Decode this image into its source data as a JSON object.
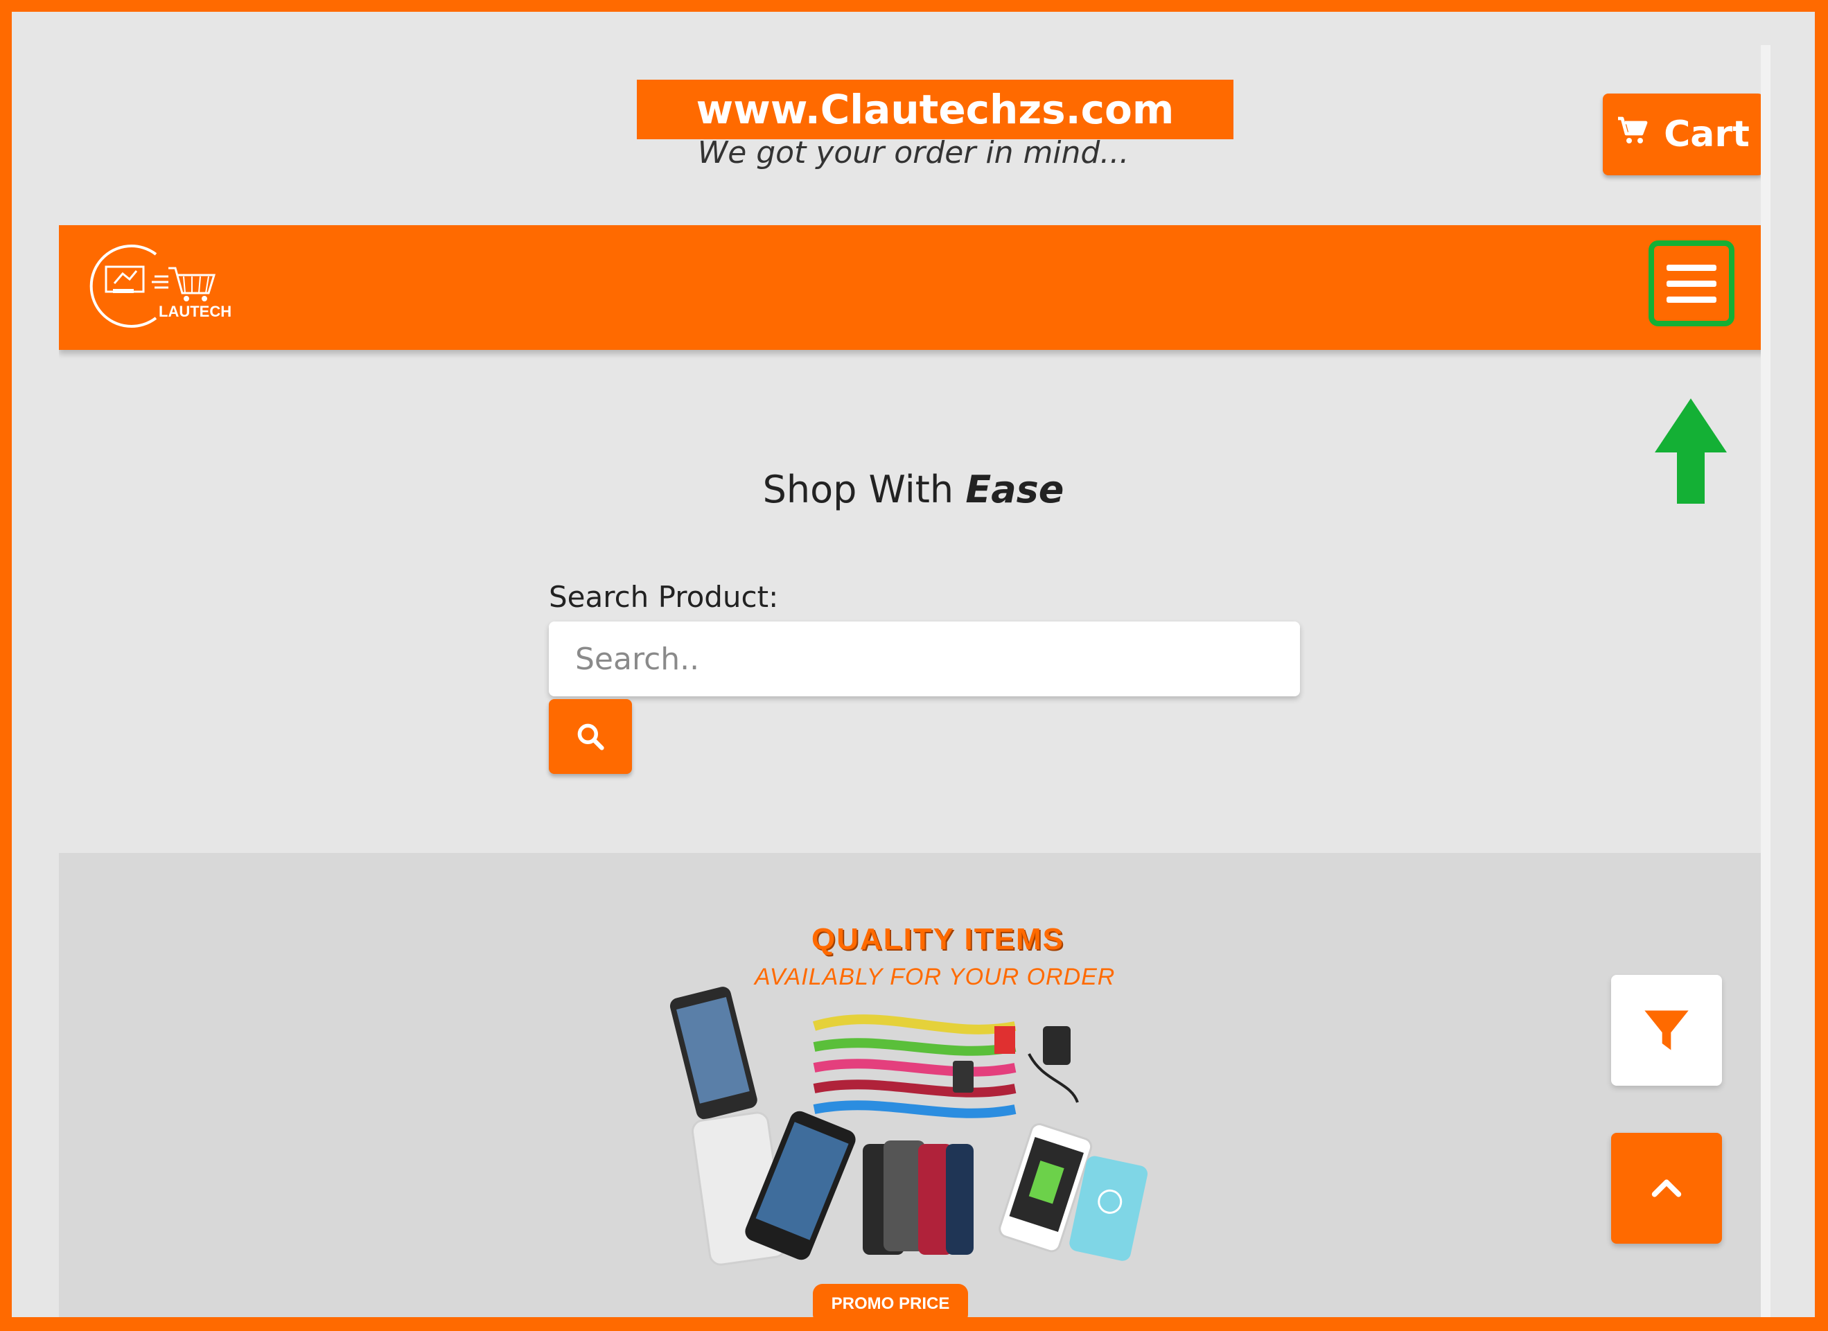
{
  "header": {
    "url_banner": "www.Clautechzs.com",
    "tagline": "We got your order in mind...",
    "cart_label": "Cart"
  },
  "navbar": {
    "logo_text": "LAUTECH",
    "menu_icon": "hamburger-icon"
  },
  "hero": {
    "title_plain": "Shop With",
    "title_emphasis": "Ease"
  },
  "search": {
    "label": "Search Product:",
    "placeholder": "Search..",
    "button_icon": "search-icon"
  },
  "promo": {
    "title": "QUALITY ITEMS",
    "subtitle": "AVAILABLY FOR YOUR ORDER",
    "button_label": "PROMO PRICE"
  },
  "floating": {
    "filter_icon": "filter-icon",
    "scroll_top_icon": "chevron-up-icon"
  },
  "colors": {
    "brand_orange": "#ff6a00",
    "highlight_green": "#14b035",
    "page_bg": "#e6e6e6"
  }
}
